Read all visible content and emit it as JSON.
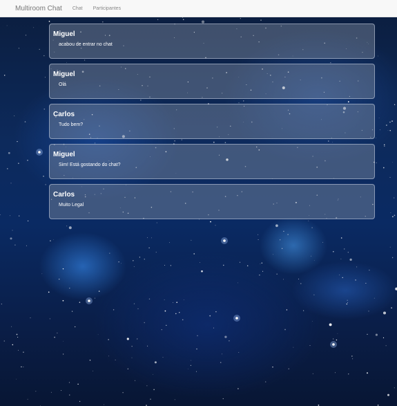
{
  "navbar": {
    "brand": "Multiroom Chat",
    "links": [
      "Chat",
      "Participantes"
    ]
  },
  "messages": [
    {
      "author": "Miguel",
      "text": "acabou de entrar no chat"
    },
    {
      "author": "Miguel",
      "text": "Olá"
    },
    {
      "author": "Carlos",
      "text": "Tudo bem?"
    },
    {
      "author": "Miguel",
      "text": "Sim! Está gostando do chat?"
    },
    {
      "author": "Carlos",
      "text": "Muito Legal"
    }
  ],
  "colors": {
    "navbar_bg": "#f8f8f8",
    "background_space": "#0d2a5c",
    "message_text": "#ffffff"
  }
}
